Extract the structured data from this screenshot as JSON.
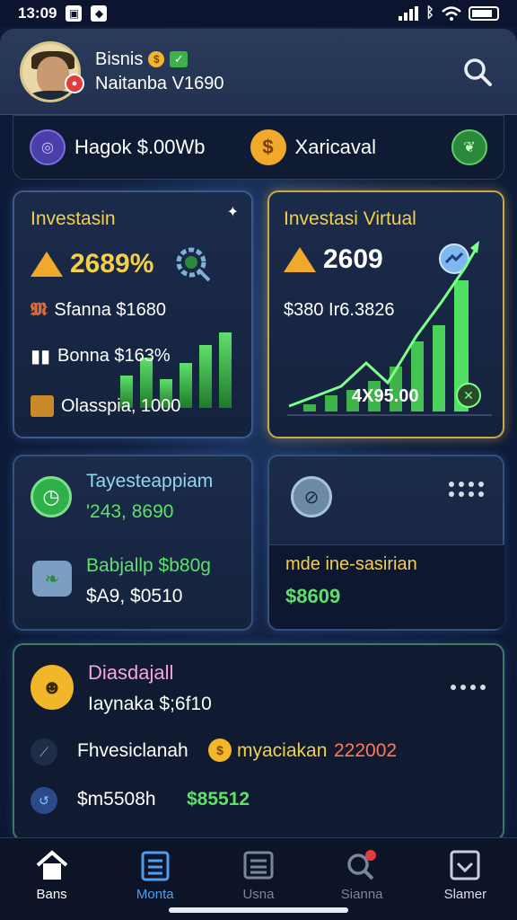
{
  "status_bar": {
    "time": "13:09"
  },
  "header": {
    "user_name": "Bisnis",
    "user_subtitle": "Naitanba V1690"
  },
  "balance_bar": {
    "left_text": "Hagok $.00Wb",
    "right_text": "Xaricaval"
  },
  "investment_card": {
    "title": "Investasin",
    "value": "2689%",
    "line1": "Sfanna $1680",
    "line2": "Bonna $163%",
    "line3": "Olasspia, 1000"
  },
  "virtual_card": {
    "title": "Investasi Virtual",
    "value": "2609",
    "line1": "$380 Ir6.3826",
    "chart_label": "4X95.00"
  },
  "task_card": {
    "title": "Tayesteappiam",
    "value": "'243, 8690",
    "label": "Babjallp $b80g",
    "amount": "$A9, $0510"
  },
  "side_card": {
    "label": "mde ine-sasirian",
    "value": "$8609"
  },
  "discount_card": {
    "title": "Diasdajall",
    "subtitle": "Iaynaka $;6f10",
    "row1_left": "Fhvesiclanah",
    "row1_mid": "myaciakan",
    "row1_right": "222002",
    "row2_left": "$m5508h",
    "row2_right": "$85512"
  },
  "nav": {
    "items": [
      {
        "label": "Bans"
      },
      {
        "label": "Monta"
      },
      {
        "label": "Usna"
      },
      {
        "label": "Sianna"
      },
      {
        "label": "Slamer"
      }
    ]
  },
  "colors": {
    "accent_gold": "#f3cf4a",
    "accent_green": "#5ee06b",
    "accent_blue": "#4d9df0",
    "background": "#122240"
  }
}
